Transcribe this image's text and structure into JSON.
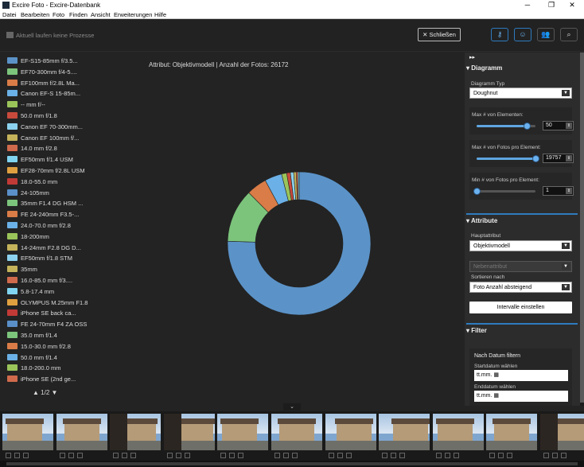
{
  "window": {
    "title": "Excire Foto - Excire-Datenbank",
    "min_glyph": "─",
    "max_glyph": "❐",
    "close_glyph": "✕"
  },
  "menu": [
    "Datei",
    "Bearbeiten",
    "Foto",
    "Finden",
    "Ansicht",
    "Erweiterungen",
    "Hilfe"
  ],
  "status": {
    "process_text": "Aktuell laufen keine Prozesse",
    "close_label": "✕ Schließen"
  },
  "toolbar": [
    {
      "icon": "key-icon",
      "glyph": "⚷"
    },
    {
      "icon": "face-icon",
      "glyph": "☺"
    },
    {
      "icon": "people-icon",
      "glyph": "👥"
    },
    {
      "icon": "zoom-icon",
      "glyph": "⌕"
    }
  ],
  "legend": [
    {
      "label": "EF-S15-85mm f/3.5...",
      "color": "#5b93c8"
    },
    {
      "label": "EF70-300mm f/4-5....",
      "color": "#7cc47c"
    },
    {
      "label": "EF100mm f/2.8L Ma...",
      "color": "#d97c47"
    },
    {
      "label": "Canon EF-S 15-85m...",
      "color": "#6bb0e6"
    },
    {
      "label": "-- mm f/--",
      "color": "#9ac45a"
    },
    {
      "label": "50.0 mm f/1.8",
      "color": "#c84a3c"
    },
    {
      "label": "Canon EF 70-300mm...",
      "color": "#8cd2ee"
    },
    {
      "label": "Canon EF 100mm f/...",
      "color": "#c4b35a"
    },
    {
      "label": "14.0 mm f/2.8",
      "color": "#d06a4c"
    },
    {
      "label": "EF50mm f/1.4 USM",
      "color": "#80d4f0"
    },
    {
      "label": "EF28-70mm f/2.8L USM",
      "color": "#e0a040"
    },
    {
      "label": "18.0-55.0 mm",
      "color": "#c23a36"
    },
    {
      "label": "24-105mm",
      "color": "#5a8fc8"
    },
    {
      "label": "35mm F1.4 DG HSM ...",
      "color": "#7cc47c"
    },
    {
      "label": "FE 24-240mm F3.5-...",
      "color": "#d97c47"
    },
    {
      "label": "24.0-70.0 mm f/2.8",
      "color": "#6bb0e6"
    },
    {
      "label": "18-200mm",
      "color": "#9ac45a"
    },
    {
      "label": "14-24mm F2.8 DG D...",
      "color": "#c4b35a"
    },
    {
      "label": "EF50mm f/1.8 STM",
      "color": "#8cd2ee"
    },
    {
      "label": "35mm",
      "color": "#c4b35a"
    },
    {
      "label": "16.0-85.0 mm f/3....",
      "color": "#d06a4c"
    },
    {
      "label": "5.8-17.4 mm",
      "color": "#80d4f0"
    },
    {
      "label": "OLYMPUS M.25mm F1.8",
      "color": "#e0a040"
    },
    {
      "label": "iPhone SE back ca...",
      "color": "#c23a36"
    },
    {
      "label": "FE 24-70mm F4 ZA OSS",
      "color": "#5a8fc8"
    },
    {
      "label": "35.0 mm f/1.4",
      "color": "#7cc47c"
    },
    {
      "label": "15.0-30.0 mm f/2.8",
      "color": "#d97c47"
    },
    {
      "label": "50.0 mm f/1.4",
      "color": "#6bb0e6"
    },
    {
      "label": "18.0-200.0 mm",
      "color": "#9ac45a"
    },
    {
      "label": "iPhone SE (2nd ge...",
      "color": "#d06a4c"
    }
  ],
  "pager": {
    "text": "▲ 1/2 ▼"
  },
  "chart_data": {
    "type": "pie",
    "variant": "doughnut",
    "title": "Attribut: Objektivmodell | Anzahl der Fotos: 26172",
    "categories": [
      "EF-S15-85mm f/3.5...",
      "EF70-300mm f/4-5....",
      "EF100mm f/2.8L Ma...",
      "Canon EF-S 15-85m...",
      "-- mm f/--",
      "50.0 mm f/1.8",
      "Canon EF 70-300mm...",
      "Canon EF 100mm f/...",
      "14.0 mm f/2.8",
      "EF50mm f/1.4 USM"
    ],
    "values": [
      19757,
      3160,
      1200,
      1020,
      300,
      220,
      190,
      150,
      95,
      80
    ],
    "colors": [
      "#5b93c8",
      "#7cc47c",
      "#d97c47",
      "#6bb0e6",
      "#9ac45a",
      "#c84a3c",
      "#8cd2ee",
      "#c4b35a",
      "#d06a4c",
      "#80d4f0"
    ]
  },
  "panel": {
    "diagramm": {
      "title": "Diagramm",
      "typ_label": "Diagramm Typ",
      "typ_value": "Doughnut",
      "max_elem_label": "Max # von Elementen:",
      "max_elem_value": "50",
      "max_elem_level": 0.85,
      "max_fotos_label": "Max # von Fotos pro Element:",
      "max_fotos_value": "19757",
      "max_fotos_level": 1.0,
      "min_fotos_label": "Min # von Fotos pro Element:",
      "min_fotos_value": "1",
      "min_fotos_level": 0.0
    },
    "attribute": {
      "title": "Attribute",
      "haupt_label": "Hauptattribut",
      "haupt_value": "Objektivmodell",
      "neben_placeholder": "Nebenattribut",
      "sort_label": "Sortieren nach",
      "sort_value": "Foto Anzahl absteigend",
      "interval_button": "Intervalle einstellen"
    },
    "filter": {
      "title": "Filter",
      "date_title": "Nach Datum filtern",
      "start_label": "Startdatum wählen",
      "start_value": "tt.mm.",
      "end_label": "Enddatum wählen",
      "end_value": "tt.mm."
    },
    "collapse_glyph": "▸▸"
  },
  "film_glyph": "⌄"
}
